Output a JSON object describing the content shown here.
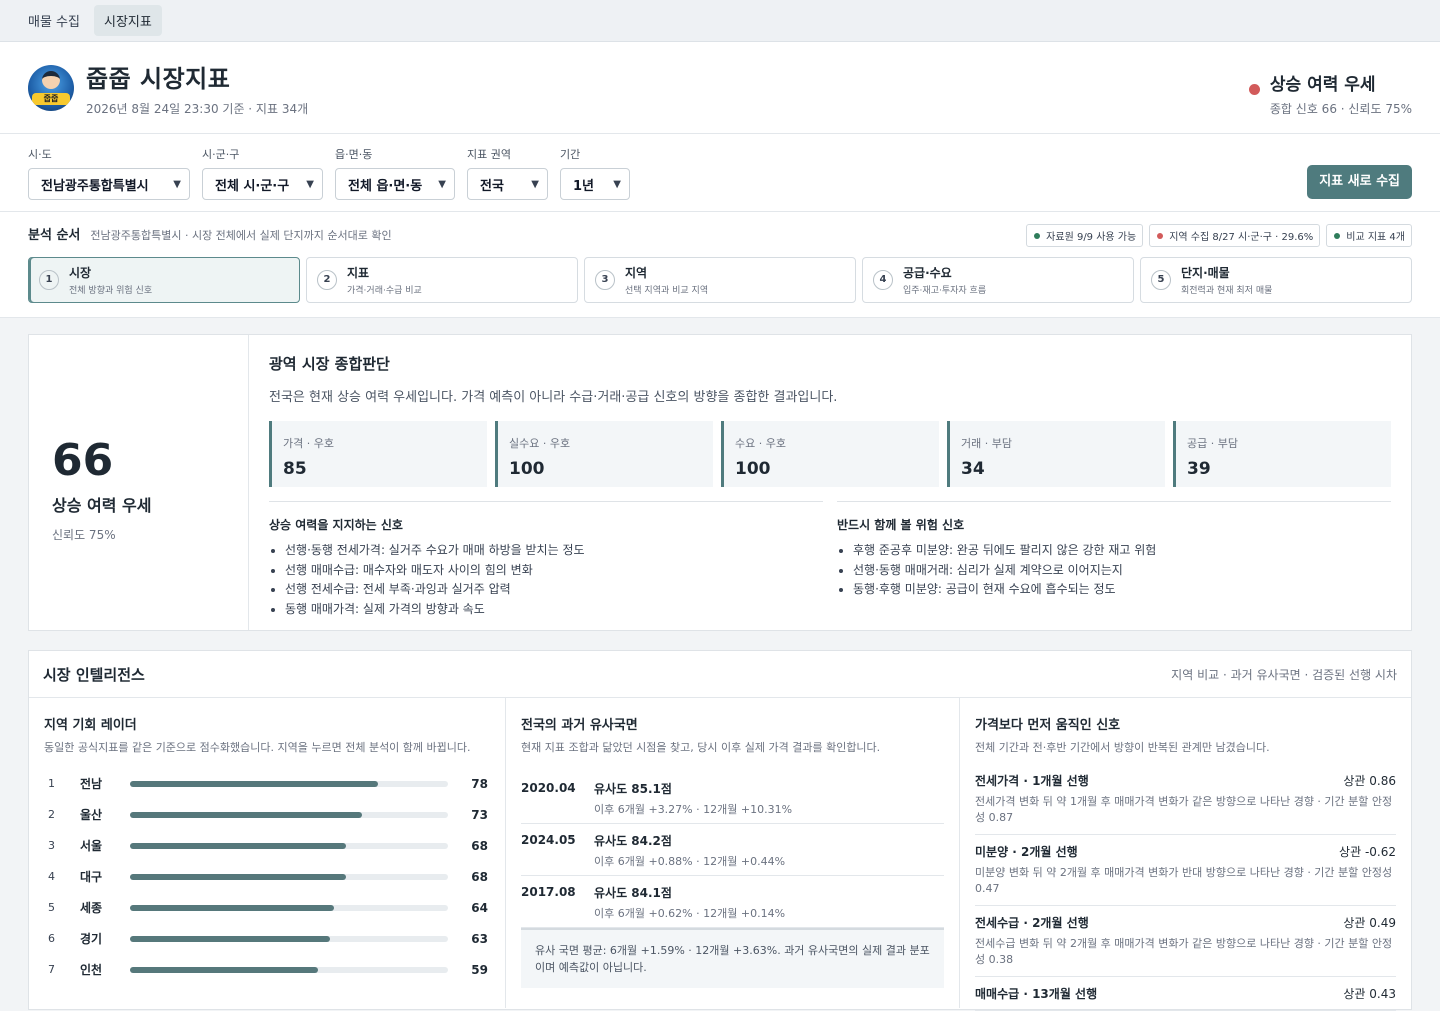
{
  "nav": {
    "tabs": [
      "매물 수집",
      "시장지표"
    ]
  },
  "header": {
    "title": "줍줍 시장지표",
    "subtitle": "2026년 8월 24일 23:30 기준 · 지표 34개",
    "logo_text": "줍줍",
    "status_label": "상승 여력 우세",
    "status_meta": "종합 신호 66 · 신뢰도 75%",
    "status_color": "#d25a5a"
  },
  "filters": {
    "sido": {
      "label": "시·도",
      "value": "전남광주통합특별시"
    },
    "sigungu": {
      "label": "시·군·구",
      "value": "전체 시·군·구"
    },
    "dong": {
      "label": "읍·면·동",
      "value": "전체 읍·면·동"
    },
    "scope": {
      "label": "지표 권역",
      "value": "전국"
    },
    "period": {
      "label": "기간",
      "value": "1년"
    },
    "refresh_label": "지표 새로 수집"
  },
  "analysis": {
    "title": "분석 순서",
    "desc": "전남광주통합특별시 · 시장 전체에서 실제 단지까지 순서대로 확인",
    "pills": [
      {
        "text": "자료원 9/9 사용 가능",
        "color": "#2f7d5b"
      },
      {
        "text": "지역 수집 8/27 시·군·구 · 29.6%",
        "color": "#d25a5a"
      },
      {
        "text": "비교 지표 4개",
        "color": "#2f7d5b"
      }
    ],
    "steps": [
      {
        "num": "1",
        "title": "시장",
        "desc": "전체 방향과 위험 신호"
      },
      {
        "num": "2",
        "title": "지표",
        "desc": "가격·거래·수급 비교"
      },
      {
        "num": "3",
        "title": "지역",
        "desc": "선택 지역과 비교 지역"
      },
      {
        "num": "4",
        "title": "공급·수요",
        "desc": "입주·재고·투자자 흐름"
      },
      {
        "num": "5",
        "title": "단지·매물",
        "desc": "회전력과 현재 최저 매물"
      }
    ]
  },
  "verdict": {
    "score": "66",
    "label": "상승 여력 우세",
    "confidence": "신뢰도 75%",
    "title": "광역 시장 종합판단",
    "desc": "전국은 현재 상승 여력 우세입니다. 가격 예측이 아니라 수급·거래·공급 신호의 방향을 종합한 결과입니다.",
    "metrics": [
      {
        "label": "가격 · 우호",
        "value": "85"
      },
      {
        "label": "실수요 · 우호",
        "value": "100"
      },
      {
        "label": "수요 · 우호",
        "value": "100"
      },
      {
        "label": "거래 · 부담",
        "value": "34"
      },
      {
        "label": "공급 · 부담",
        "value": "39"
      }
    ],
    "support_title": "상승 여력을 지지하는 신호",
    "support": [
      "선행·동행 전세가격: 실거주 수요가 매매 하방을 받치는 정도",
      "선행 매매수급: 매수자와 매도자 사이의 힘의 변화",
      "선행 전세수급: 전세 부족·과잉과 실거주 압력",
      "동행 매매가격: 실제 가격의 방향과 속도"
    ],
    "risk_title": "반드시 함께 볼 위험 신호",
    "risk": [
      "후행 준공후 미분양: 완공 뒤에도 팔리지 않은 강한 재고 위험",
      "선행·동행 매매거래: 심리가 실제 계약으로 이어지는지",
      "동행·후행 미분양: 공급이 현재 수요에 흡수되는 정도"
    ]
  },
  "intel": {
    "title": "시장 인텔리전스",
    "meta": "지역 비교 · 과거 유사국면 · 검증된 선행 시차",
    "radar": {
      "title": "지역 기회 레이더",
      "desc": "동일한 공식지표를 같은 기준으로 점수화했습니다. 지역을 누르면 전체 분석이 함께 바뀝니다.",
      "items": [
        {
          "rank": "1",
          "name": "전남",
          "score": 78,
          "score_text": "78"
        },
        {
          "rank": "2",
          "name": "울산",
          "score": 73,
          "score_text": "73"
        },
        {
          "rank": "3",
          "name": "서울",
          "score": 68,
          "score_text": "68"
        },
        {
          "rank": "4",
          "name": "대구",
          "score": 68,
          "score_text": "68"
        },
        {
          "rank": "5",
          "name": "세종",
          "score": 64,
          "score_text": "64"
        },
        {
          "rank": "6",
          "name": "경기",
          "score": 63,
          "score_text": "63"
        },
        {
          "rank": "7",
          "name": "인천",
          "score": 59,
          "score_text": "59"
        }
      ]
    },
    "history": {
      "title": "전국의 과거 유사국면",
      "desc": "현재 지표 조합과 닮았던 시점을 찾고, 당시 이후 실제 가격 결과를 확인합니다.",
      "items": [
        {
          "period": "2020.04",
          "sim": "유사도 85.1점",
          "result": "이후 6개월 +3.27% · 12개월 +10.31%"
        },
        {
          "period": "2024.05",
          "sim": "유사도 84.2점",
          "result": "이후 6개월 +0.88% · 12개월 +0.44%"
        },
        {
          "period": "2017.08",
          "sim": "유사도 84.1점",
          "result": "이후 6개월 +0.62% · 12개월 +0.14%"
        }
      ],
      "avg": "유사 국면 평균: 6개월 +1.59% · 12개월 +3.63%. 과거 유사국면의 실제 결과 분포이며 예측값이 아닙니다."
    },
    "lead": {
      "title": "가격보다 먼저 움직인 신호",
      "desc": "전체 기간과 전·후반 기간에서 방향이 반복된 관계만 남겼습니다.",
      "items": [
        {
          "name": "전세가격 · 1개월 선행",
          "corr": "상관 0.86",
          "desc": "전세가격 변화 뒤 약 1개월 후 매매가격 변화가 같은 방향으로 나타난 경향 · 기간 분할 안정성 0.87"
        },
        {
          "name": "미분양 · 2개월 선행",
          "corr": "상관 -0.62",
          "desc": "미분양 변화 뒤 약 2개월 후 매매가격 변화가 반대 방향으로 나타난 경향 · 기간 분할 안정성 0.47"
        },
        {
          "name": "전세수급 · 2개월 선행",
          "corr": "상관 0.49",
          "desc": "전세수급 변화 뒤 약 2개월 후 매매가격 변화가 같은 방향으로 나타난 경향 · 기간 분할 안정성 0.38"
        },
        {
          "name": "매매수급 · 13개월 선행",
          "corr": "상관 0.43",
          "desc": ""
        }
      ]
    }
  }
}
